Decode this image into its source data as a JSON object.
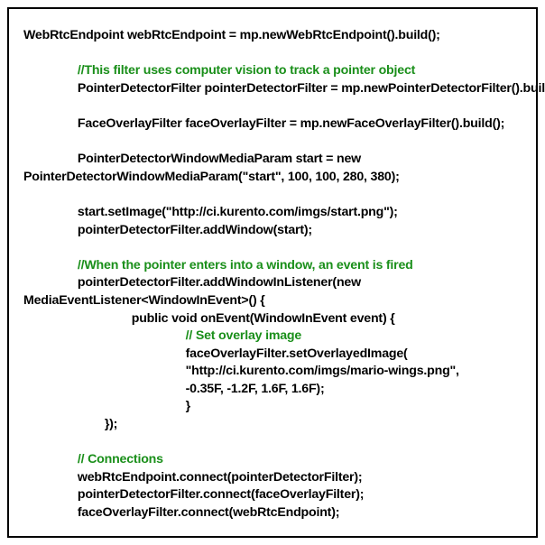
{
  "lines": [
    {
      "indent": 0,
      "text": "WebRtcEndpoint webRtcEndpoint = mp.newWebRtcEndpoint().build();",
      "type": "code"
    },
    {
      "indent": 0,
      "text": " ",
      "type": "code"
    },
    {
      "indent": 2,
      "text": "//This filter uses computer vision to track a pointer object",
      "type": "comment"
    },
    {
      "indent": 2,
      "text": "PointerDetectorFilter pointerDetectorFilter = mp.newPointerDetectorFilter().build();",
      "type": "code"
    },
    {
      "indent": 0,
      "text": " ",
      "type": "code"
    },
    {
      "indent": 2,
      "text": "FaceOverlayFilter faceOverlayFilter = mp.newFaceOverlayFilter().build();",
      "type": "code"
    },
    {
      "indent": 0,
      "text": " ",
      "type": "code"
    },
    {
      "indent": 2,
      "text": "PointerDetectorWindowMediaParam start = new",
      "type": "code"
    },
    {
      "indent": 0,
      "text": "PointerDetectorWindowMediaParam(\"start\", 100, 100, 280, 380);",
      "type": "code"
    },
    {
      "indent": 0,
      "text": " ",
      "type": "code"
    },
    {
      "indent": 2,
      "text": "start.setImage(\"http://ci.kurento.com/imgs/start.png\");",
      "type": "code"
    },
    {
      "indent": 2,
      "text": "pointerDetectorFilter.addWindow(start);",
      "type": "code"
    },
    {
      "indent": 0,
      "text": " ",
      "type": "code"
    },
    {
      "indent": 2,
      "text": "//When the pointer enters into a window, an event is fired",
      "type": "comment"
    },
    {
      "indent": 2,
      "text": "pointerDetectorFilter.addWindowInListener(new",
      "type": "code"
    },
    {
      "indent": 0,
      "text": "MediaEventListener<WindowInEvent>() {",
      "type": "code"
    },
    {
      "indent": 4,
      "text": "public void onEvent(WindowInEvent event) {",
      "type": "code"
    },
    {
      "indent": 6,
      "text": "// Set overlay image",
      "type": "comment"
    },
    {
      "indent": 6,
      "text": "faceOverlayFilter.setOverlayedImage(",
      "type": "code"
    },
    {
      "indent": 6,
      "text": "\"http://ci.kurento.com/imgs/mario-wings.png\",",
      "type": "code"
    },
    {
      "indent": 6,
      "text": "-0.35F, -1.2F, 1.6F, 1.6F);",
      "type": "code"
    },
    {
      "indent": 6,
      "text": "}",
      "type": "code"
    },
    {
      "indent": 3,
      "text": "});",
      "type": "code"
    },
    {
      "indent": 0,
      "text": " ",
      "type": "code"
    },
    {
      "indent": 2,
      "text": "// Connections",
      "type": "comment"
    },
    {
      "indent": 2,
      "text": "webRtcEndpoint.connect(pointerDetectorFilter);",
      "type": "code"
    },
    {
      "indent": 2,
      "text": "pointerDetectorFilter.connect(faceOverlayFilter);",
      "type": "code"
    },
    {
      "indent": 2,
      "text": "faceOverlayFilter.connect(webRtcEndpoint);",
      "type": "code"
    }
  ]
}
